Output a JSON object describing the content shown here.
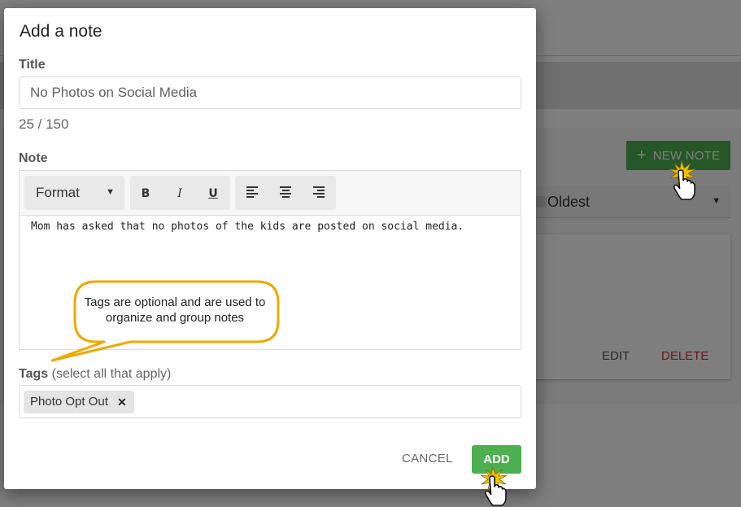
{
  "background": {
    "new_note_label": "NEW NOTE",
    "sort_value": "Oldest",
    "edit_label": "EDIT",
    "delete_label": "DELETE"
  },
  "dialog": {
    "title": "Add a note",
    "title_field": {
      "label": "Title",
      "value": "No Photos on Social Media",
      "counter": "25 / 150"
    },
    "note_field": {
      "label": "Note",
      "format_label": "Format",
      "bold": "B",
      "italic": "I",
      "underline": "U",
      "body": "Mom has asked that no photos of the kids are posted on social media."
    },
    "tags_field": {
      "label": "Tags",
      "hint": "(select all that apply)",
      "chips": [
        {
          "label": "Photo Opt Out"
        }
      ]
    },
    "actions": {
      "cancel": "CANCEL",
      "add": "ADD"
    }
  },
  "callout": {
    "text": "Tags are optional and are used to organize and group notes"
  },
  "colors": {
    "accent_green": "#4caf50",
    "callout_border": "#f0a800",
    "delete_red": "#d32f2f"
  },
  "icons": [
    "plus-icon",
    "caret-down-icon",
    "close-icon",
    "align-left-icon",
    "align-center-icon",
    "align-right-icon",
    "hand-pointer-icon"
  ]
}
